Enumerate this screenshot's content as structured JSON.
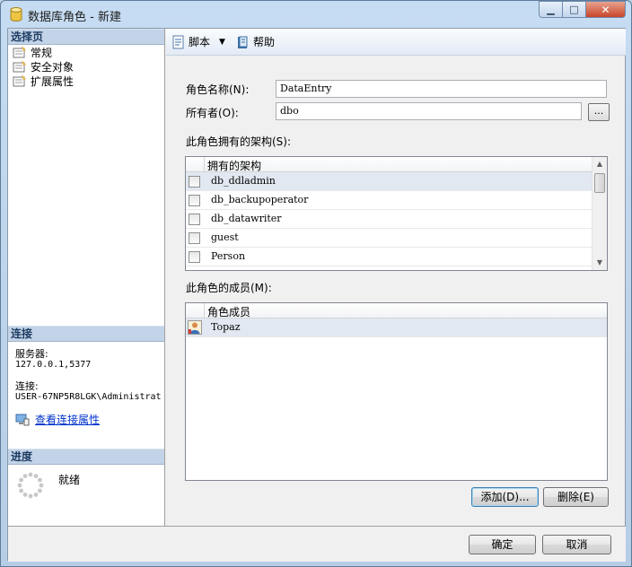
{
  "window": {
    "title": "数据库角色 - 新建",
    "controls": {
      "minimize": "▁",
      "maximize": "□",
      "close": "✕"
    }
  },
  "left_panel": {
    "select_page_header": "选择页",
    "pages": [
      {
        "label": "常规",
        "icon": "page-icon"
      },
      {
        "label": "安全对象",
        "icon": "page-icon"
      },
      {
        "label": "扩展属性",
        "icon": "page-icon"
      }
    ],
    "connection_header": "连接",
    "server_label": "服务器:",
    "server_value": "127.0.0.1,5377",
    "connection_label": "连接:",
    "connection_value": "USER-67NP5R8LGK\\Administrat",
    "view_connection_link": "查看连接属性",
    "progress_header": "进度",
    "progress_status": "就绪"
  },
  "toolbar": {
    "script_label": "脚本",
    "help_label": "帮助"
  },
  "form": {
    "role_name_label": "角色名称(N):",
    "role_name_value": "DataEntry",
    "owner_label": "所有者(O):",
    "owner_value": "dbo",
    "browse_button": "...",
    "schemas_label": "此角色拥有的架构(S):",
    "schemas_column": "拥有的架构",
    "schemas": [
      {
        "name": "db_ddladmin",
        "checked": false
      },
      {
        "name": "db_backupoperator",
        "checked": false
      },
      {
        "name": "db_datawriter",
        "checked": false
      },
      {
        "name": "guest",
        "checked": false
      },
      {
        "name": "Person",
        "checked": false
      }
    ],
    "members_label": "此角色的成员(M):",
    "members_column": "角色成员",
    "members": [
      {
        "name": "Topaz",
        "icon": "user-icon"
      }
    ],
    "add_button": "添加(D)...",
    "remove_button": "删除(E)"
  },
  "footer": {
    "ok_button": "确定",
    "cancel_button": "取消"
  }
}
